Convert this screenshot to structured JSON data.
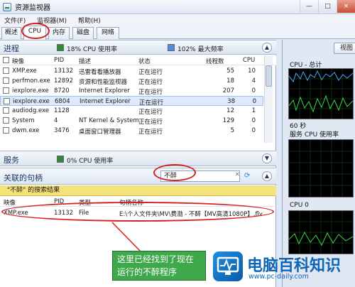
{
  "window": {
    "title": "资源监视器",
    "controls": [
      "—",
      "□",
      "×"
    ]
  },
  "menu": [
    "文件(F)",
    "监视器(M)",
    "帮助(H)"
  ],
  "tabs": [
    {
      "label": "概述"
    },
    {
      "label": "CPU"
    },
    {
      "label": "内存"
    },
    {
      "label": "磁盘"
    },
    {
      "label": "网络"
    }
  ],
  "processes": {
    "title": "进程",
    "cpu_usage": "18% CPU 使用率",
    "max_freq": "102% 最大频率",
    "columns": [
      "映像",
      "PID",
      "描述",
      "状态",
      "线程数",
      "CPU"
    ],
    "rows": [
      {
        "image": "XMP.exe",
        "pid": "13132",
        "desc": "迅雷看看播放器",
        "status": "正在运行",
        "threads": "55",
        "cpu": "10"
      },
      {
        "image": "perfmon.exe",
        "pid": "12892",
        "desc": "资源和性能监视器",
        "status": "正在运行",
        "threads": "18",
        "cpu": "4"
      },
      {
        "image": "iexplore.exe",
        "pid": "8720",
        "desc": "Internet Explorer",
        "status": "正在运行",
        "threads": "207",
        "cpu": "0"
      },
      {
        "image": "iexplore.exe",
        "pid": "6804",
        "desc": "Internet Explorer",
        "status": "正在运行",
        "threads": "38",
        "cpu": "0"
      },
      {
        "image": "audiodg.exe",
        "pid": "1128",
        "desc": "",
        "status": "正在运行",
        "threads": "12",
        "cpu": "1"
      },
      {
        "image": "System",
        "pid": "4",
        "desc": "NT Kernel & System",
        "status": "正在运行",
        "threads": "129",
        "cpu": "0"
      },
      {
        "image": "dwm.exe",
        "pid": "3476",
        "desc": "桌面窗口管理器",
        "status": "正在运行",
        "threads": "5",
        "cpu": "0"
      }
    ]
  },
  "services": {
    "title": "服务",
    "cpu_usage": "0% CPU 使用率"
  },
  "handles": {
    "title": "关联的句柄",
    "search_value": "不醉",
    "result_text": "\"不醉\" 的搜索结果",
    "columns": [
      "映像",
      "PID",
      "类型",
      "句柄名称"
    ],
    "row": {
      "image": "XMP.exe",
      "pid": "13132",
      "type": "File",
      "name": "E:\\个人文件夹\\MV\\费渤 - 不醉【MV高清1080P】.flv"
    }
  },
  "callout": {
    "line1": "这里已经找到了现在",
    "line2": "运行的不醉程序"
  },
  "right_panel": {
    "view_button": "视图",
    "cpu_total": "CPU - 总计",
    "time_label": "60 秒",
    "service_usage": "服务 CPU 使用率",
    "cpu0": "CPU 0"
  },
  "watermark": {
    "name": "电脑百科知识",
    "url": "www.pc-daily.com"
  },
  "colors": {
    "accent_red": "#d42020",
    "graph_green": "#3dd64a",
    "graph_blue": "#4aa3ff",
    "callout_green": "#3fa84a"
  }
}
